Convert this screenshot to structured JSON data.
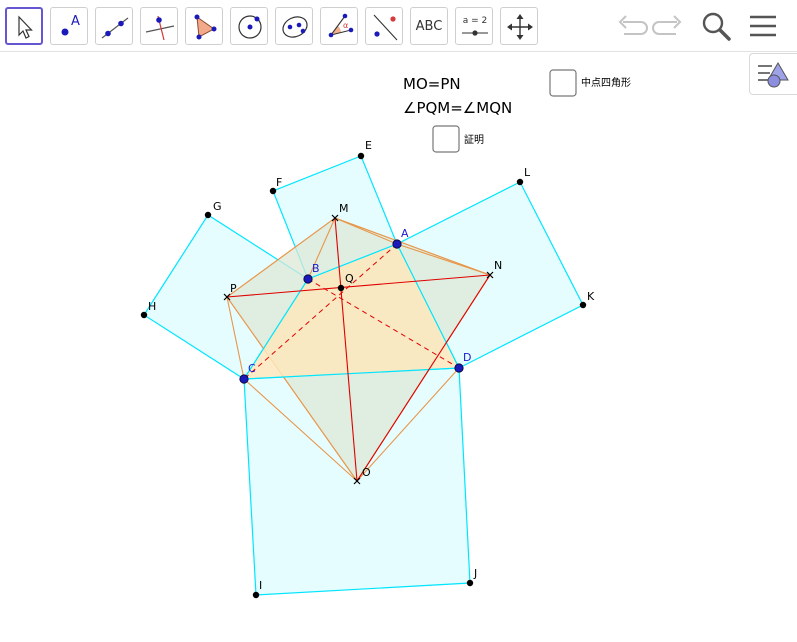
{
  "toolbar": {
    "tools": [
      {
        "name": "move",
        "active": true
      },
      {
        "name": "point",
        "label": "A"
      },
      {
        "name": "line"
      },
      {
        "name": "perpendicular-line"
      },
      {
        "name": "polygon"
      },
      {
        "name": "circle"
      },
      {
        "name": "conic"
      },
      {
        "name": "angle",
        "label": "α"
      },
      {
        "name": "reflect"
      },
      {
        "name": "text",
        "label": "ABC"
      },
      {
        "name": "slider",
        "label": "a = 2"
      },
      {
        "name": "move-graphics-view"
      }
    ]
  },
  "menu": {
    "undo_icon": "undo-icon",
    "redo_icon": "redo-icon",
    "search_icon": "search-icon",
    "menu_icon": "hamburger-menu-icon"
  },
  "canvas": {
    "texts": {
      "eq1": "MO=PN",
      "eq2": "∠PQM=∠MQN"
    },
    "checkboxes": [
      {
        "id": "midpoint-quad",
        "label": "中点四角形",
        "checked": false
      },
      {
        "id": "proof",
        "label": "証明",
        "checked": false
      }
    ],
    "points": {
      "E": "E",
      "F": "F",
      "G": "G",
      "H": "H",
      "M": "M",
      "A": "A",
      "B": "B",
      "Q": "Q",
      "P": "P",
      "N": "N",
      "L": "L",
      "K": "K",
      "C": "C",
      "D": "D",
      "O": "O",
      "I": "I",
      "J": "J"
    }
  },
  "colors": {
    "square_stroke": "#00e5ff",
    "square_fill": "#e6fdff",
    "orange": "#e8964a",
    "orange_fill": "#fdecc8",
    "red": "#e00000",
    "point_blue": "#1a1aba",
    "tool_active": "#6557d2"
  }
}
